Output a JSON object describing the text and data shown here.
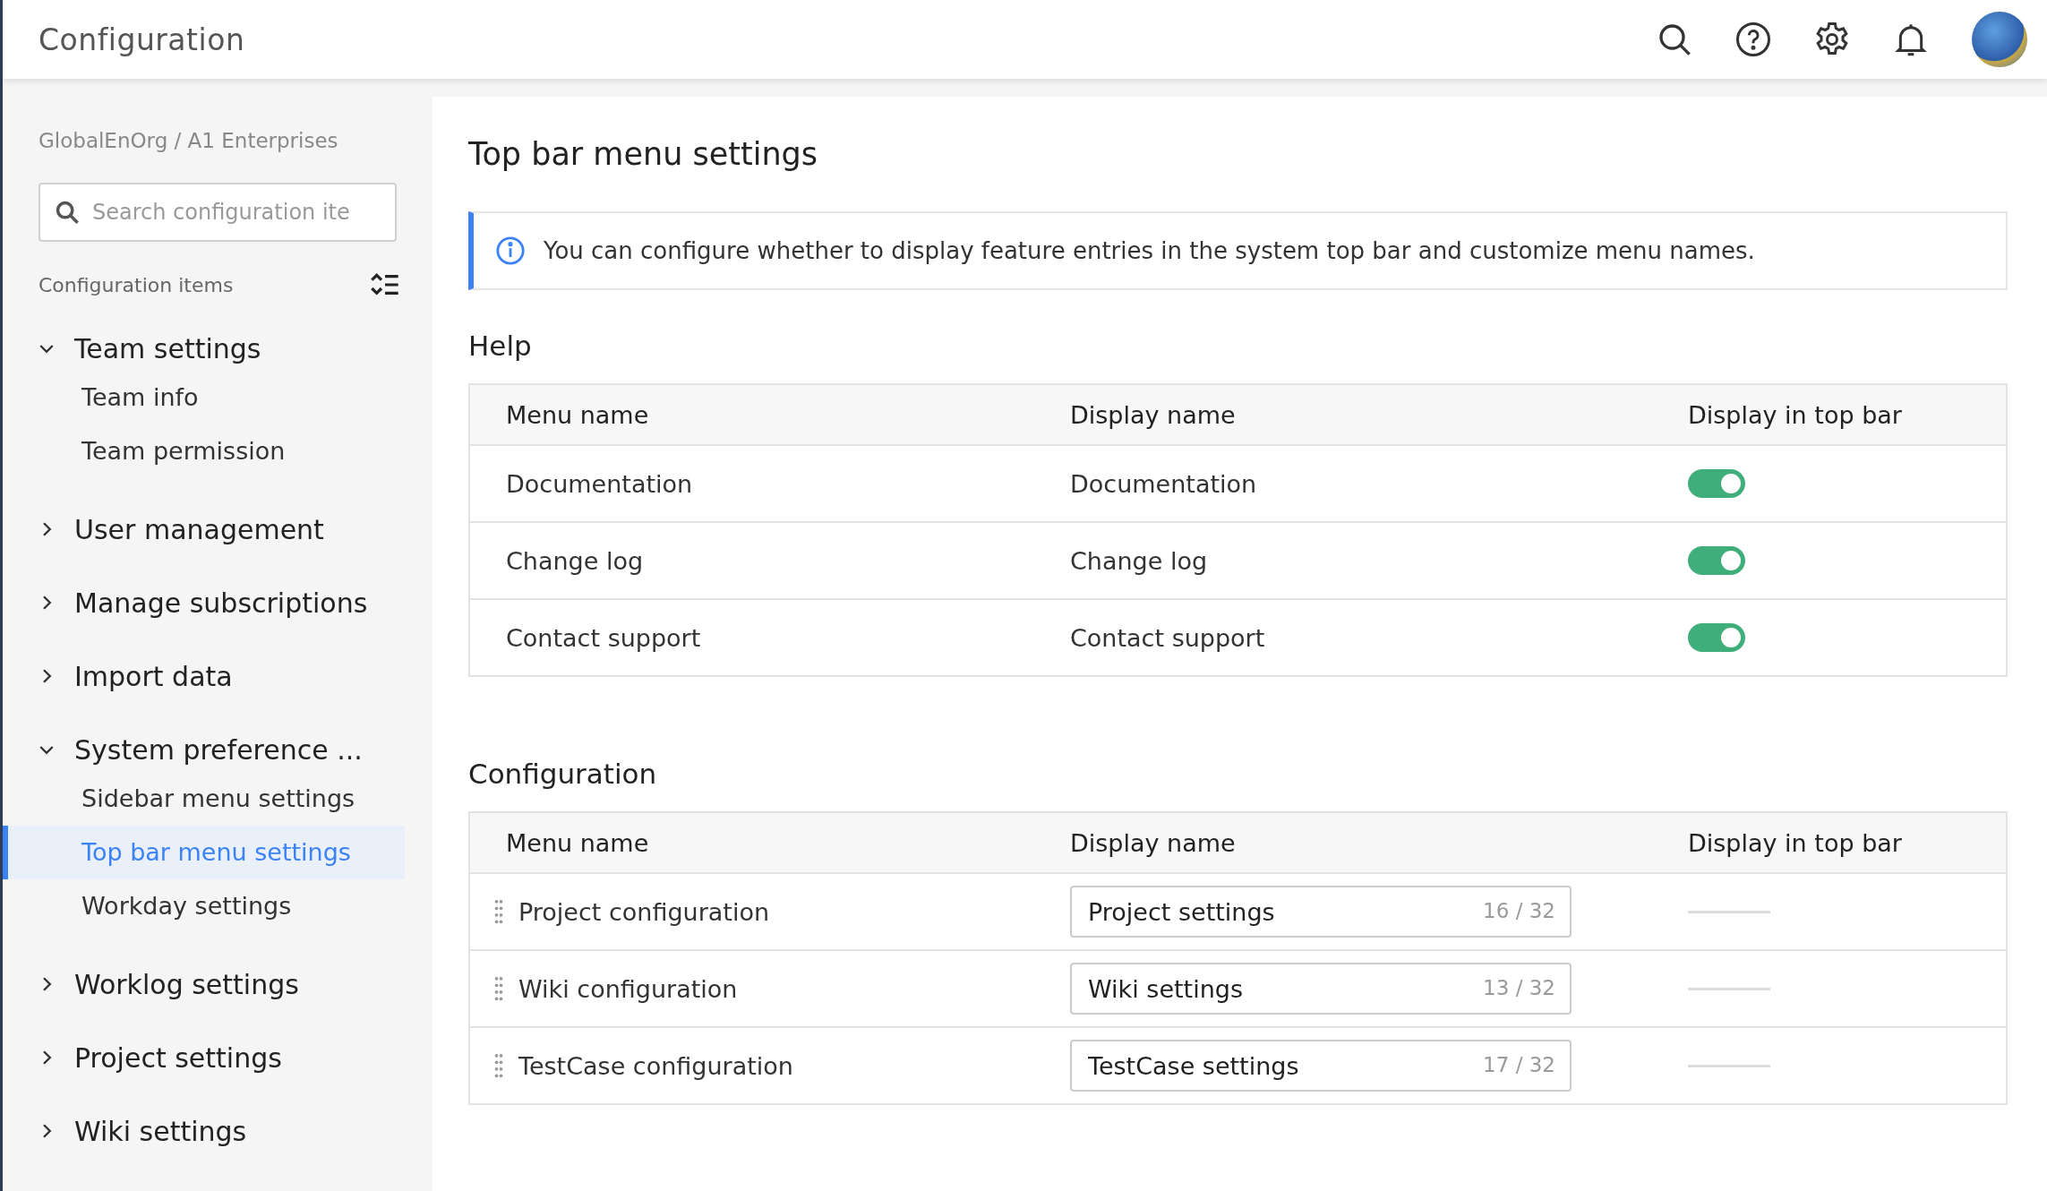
{
  "header": {
    "title": "Configuration"
  },
  "sidebar": {
    "breadcrumb": "GlobalEnOrg / A1 Enterprises",
    "search": {
      "placeholder": "Search configuration ite"
    },
    "section_label": "Configuration items",
    "tree": [
      {
        "label": "Team settings",
        "expanded": true,
        "children": [
          {
            "label": "Team info",
            "selected": false
          },
          {
            "label": "Team permission",
            "selected": false
          }
        ]
      },
      {
        "label": "User management",
        "expanded": false
      },
      {
        "label": "Manage subscriptions",
        "expanded": false
      },
      {
        "label": "Import data",
        "expanded": false
      },
      {
        "label": "System preference ...",
        "expanded": true,
        "children": [
          {
            "label": "Sidebar menu settings",
            "selected": false
          },
          {
            "label": "Top bar menu settings",
            "selected": true
          },
          {
            "label": "Workday settings",
            "selected": false
          }
        ]
      },
      {
        "label": "Worklog settings",
        "expanded": false
      },
      {
        "label": "Project settings",
        "expanded": false
      },
      {
        "label": "Wiki settings",
        "expanded": false
      }
    ]
  },
  "main": {
    "title": "Top bar menu settings",
    "info": "You can configure whether to display feature entries in the system top bar and customize menu names.",
    "sections": [
      {
        "heading": "Help",
        "columns": [
          "Menu name",
          "Display name",
          "Display in top bar"
        ],
        "rows": [
          {
            "kind": "toggle",
            "menu_name": "Documentation",
            "display_name": "Documentation",
            "on": true
          },
          {
            "kind": "toggle",
            "menu_name": "Change log",
            "display_name": "Change log",
            "on": true
          },
          {
            "kind": "toggle",
            "menu_name": "Contact support",
            "display_name": "Contact support",
            "on": true
          }
        ]
      },
      {
        "heading": "Configuration",
        "columns": [
          "Menu name",
          "Display name",
          "Display in top bar"
        ],
        "rows": [
          {
            "kind": "input",
            "menu_name": "Project configuration",
            "display_name": "Project settings",
            "count": "16 / 32"
          },
          {
            "kind": "input",
            "menu_name": "Wiki configuration",
            "display_name": "Wiki settings",
            "count": "13 / 32"
          },
          {
            "kind": "input",
            "menu_name": "TestCase configuration",
            "display_name": "TestCase settings",
            "count": "17 / 32"
          }
        ]
      }
    ]
  }
}
